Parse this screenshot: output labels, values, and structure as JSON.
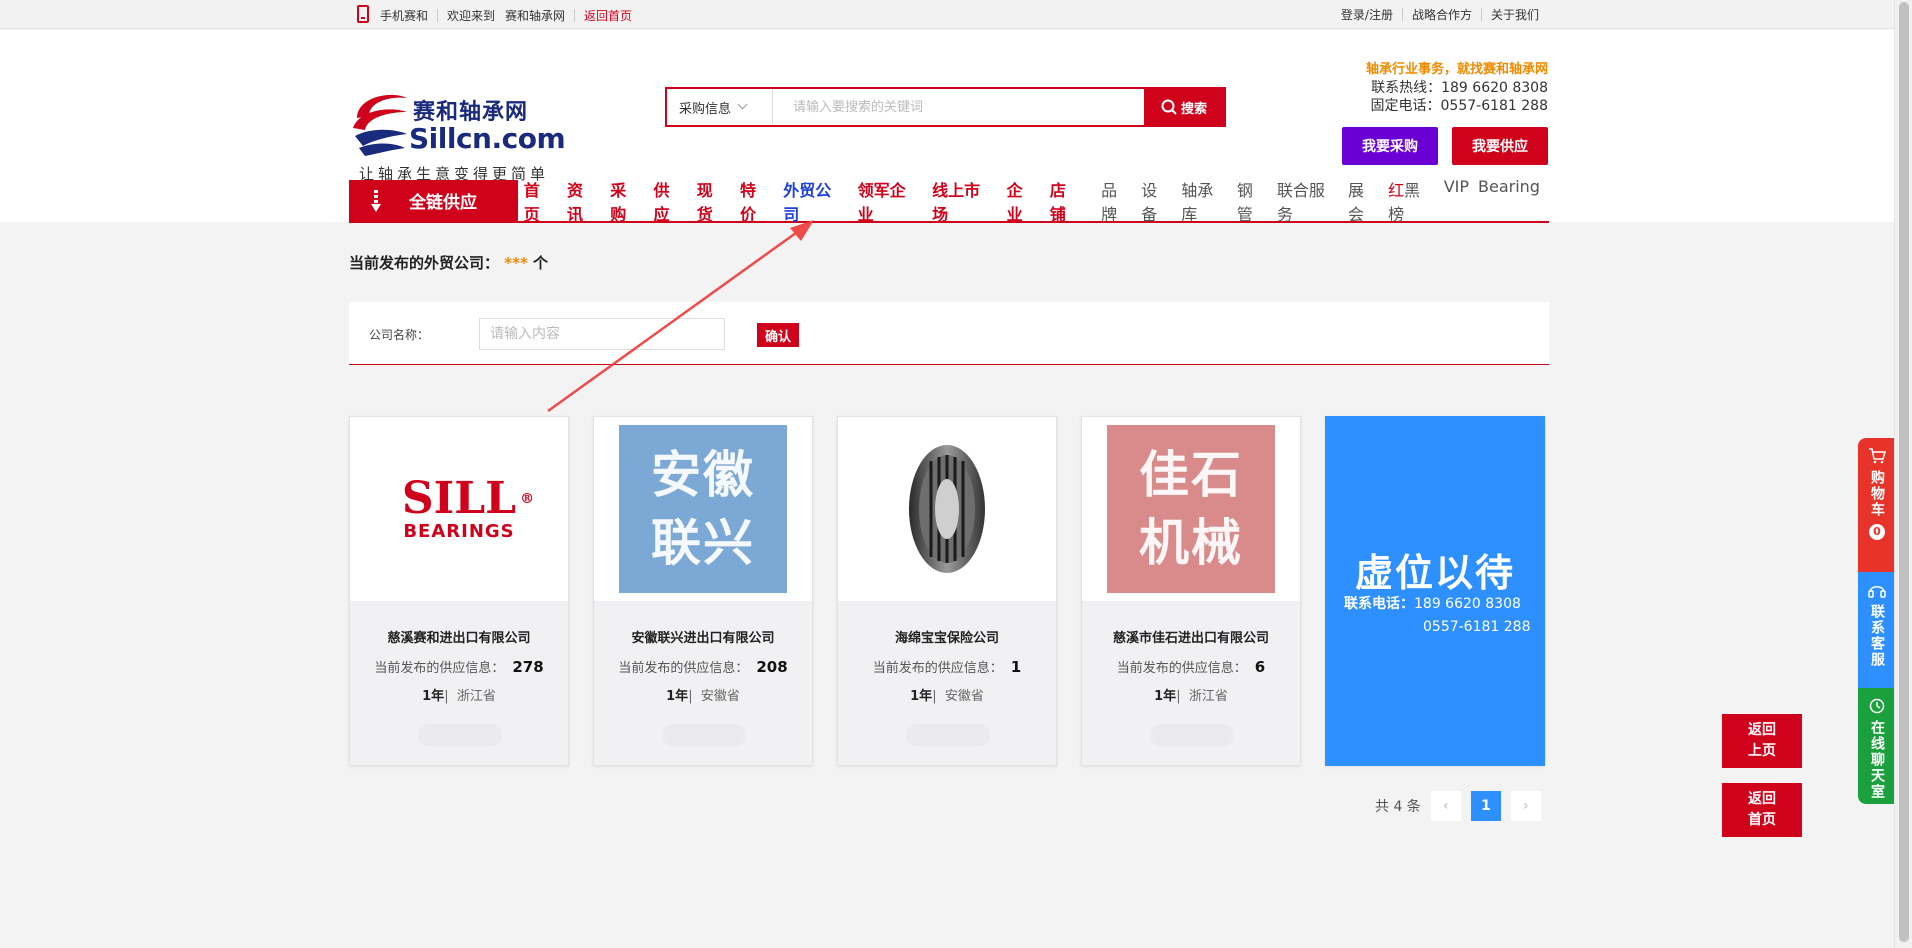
{
  "topbar": {
    "mobile": "手机赛和",
    "welcome": "欢迎来到",
    "site": "赛和轴承网",
    "home": "返回首页",
    "login": "登录/注册",
    "partner": "战略合作方",
    "about": "关于我们"
  },
  "logo": {
    "title": "赛和轴承网",
    "domain": "Sillcn.com",
    "slogan": "让轴承生意变得更简单"
  },
  "search": {
    "category": "采购信息",
    "placeholder": "请输入要搜索的关键词",
    "button": "搜索"
  },
  "contact": {
    "slogan": "轴承行业事务，就找赛和轴承网",
    "hotline": "联系热线：189 6620 8308",
    "landline": "固定电话：0557-6181 288"
  },
  "header_buttons": {
    "buy": "我要采购",
    "supply": "我要供应"
  },
  "nav": {
    "category": "全链供应",
    "main": [
      "首页",
      "资讯",
      "采购",
      "供应",
      "现货",
      "特价",
      "外贸公司",
      "领军企业",
      "线上市场",
      "企业",
      "店铺"
    ],
    "sub": [
      "品牌",
      "设备",
      "轴承库",
      "钢管",
      "联合服务",
      "展会"
    ],
    "rank_red": "红",
    "rank_black": "黑榜",
    "vip": "VIP",
    "bearing": "Bearing"
  },
  "count": {
    "label": "当前发布的外贸公司：",
    "stars": "***",
    "unit": "个"
  },
  "filter": {
    "label": "公司名称：",
    "placeholder": "请输入内容",
    "button": "确认"
  },
  "cards": [
    {
      "name": "慈溪赛和进出口有限公司",
      "info_label": "当前发布的供应信息：",
      "count": "278",
      "years": "1年",
      "province": "浙江省",
      "logo_text_1": "SILL",
      "logo_text_2": "BEARINGS",
      "logo_reg": "®"
    },
    {
      "name": "安徽联兴进出口有限公司",
      "info_label": "当前发布的供应信息：",
      "count": "208",
      "years": "1年",
      "province": "安徽省",
      "tile_line_1": "安徽",
      "tile_line_2": "联兴"
    },
    {
      "name": "海绵宝宝保险公司",
      "info_label": "当前发布的供应信息：",
      "count": "1",
      "years": "1年",
      "province": "安徽省"
    },
    {
      "name": "慈溪市佳石进出口有限公司",
      "info_label": "当前发布的供应信息：",
      "count": "6",
      "years": "1年",
      "province": "浙江省",
      "tile_line_1": "佳石",
      "tile_line_2": "机械"
    }
  ],
  "vacancy": {
    "title": "虚位以待",
    "phone_label": "联系电话：",
    "phone1": "189 6620 8308",
    "phone2": "0557-6181 288"
  },
  "pager": {
    "total": "共 4 条",
    "current": "1",
    "prev": "‹",
    "next": "›"
  },
  "sidebar": {
    "cart": "购物车",
    "cart_count": "0",
    "service": "联系客服",
    "chat": "在线聊天室"
  },
  "float": {
    "top": "返回上页",
    "home": "返回首页"
  },
  "colors": {
    "brand_red": "#d0021b",
    "purple": "#6a00d4",
    "blue": "#2e90ff",
    "green": "#1aa03c",
    "orange": "#f08a00"
  }
}
